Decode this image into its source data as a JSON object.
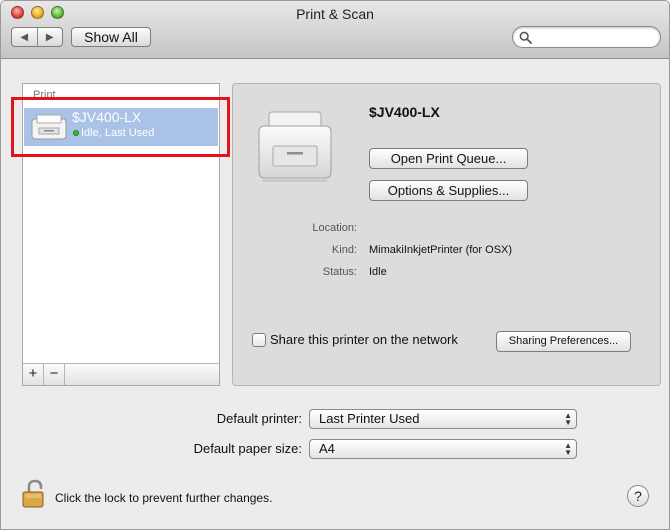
{
  "window": {
    "title": "Print & Scan"
  },
  "toolbar": {
    "back_icon": "◀",
    "forward_icon": "▶",
    "show_all_label": "Show All",
    "search_placeholder": ""
  },
  "printers_list": {
    "header": "Print",
    "items": [
      {
        "name": "$JV400-LX",
        "status": "Idle, Last Used",
        "status_color": "#2fbf2f",
        "selected": true
      }
    ],
    "add_label": "+",
    "remove_label": "−"
  },
  "detail": {
    "printer_name": "$JV400-LX",
    "open_queue_label": "Open Print Queue...",
    "options_label": "Options & Supplies...",
    "location_label": "Location:",
    "location_value": "",
    "kind_label": "Kind:",
    "kind_value": "MimakiInkjetPrinter (for OSX)",
    "status_label": "Status:",
    "status_value": "Idle",
    "share_label": "Share this printer on the network",
    "share_checked": false,
    "sharing_prefs_label": "Sharing Preferences..."
  },
  "defaults": {
    "printer_label": "Default printer:",
    "printer_value": "Last Printer Used",
    "paper_label": "Default paper size:",
    "paper_value": "A4"
  },
  "footer": {
    "lock_label": "Click the lock to prevent further changes.",
    "help_label": "?"
  },
  "annotation": {
    "highlight_color": "#e3131b"
  }
}
